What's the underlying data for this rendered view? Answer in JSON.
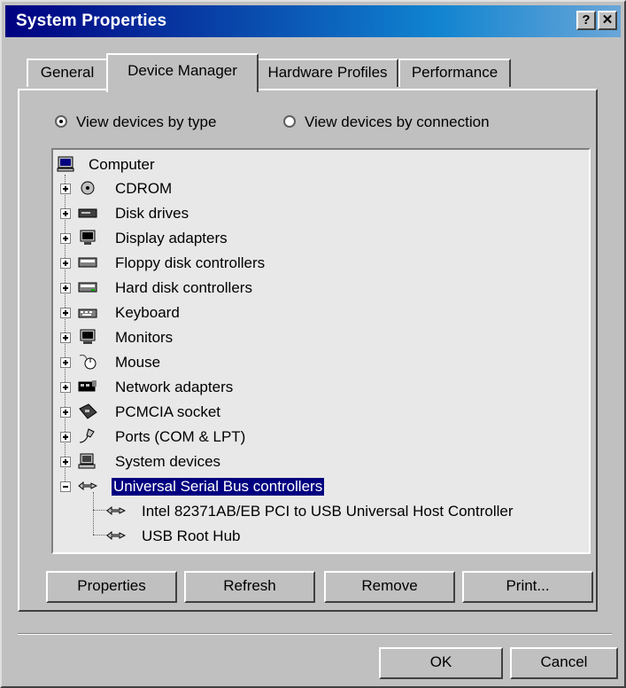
{
  "window": {
    "title": "System Properties",
    "help_glyph": "?",
    "close_glyph": "✕"
  },
  "tabs": [
    {
      "label": "General",
      "active": false
    },
    {
      "label": "Device Manager",
      "active": true
    },
    {
      "label": "Hardware Profiles",
      "active": false
    },
    {
      "label": "Performance",
      "active": false
    }
  ],
  "view_options": {
    "by_type": "View devices by type",
    "by_connection": "View devices by connection",
    "selected": "by_type"
  },
  "tree": {
    "root": {
      "label": "Computer",
      "icon": "computer-icon"
    },
    "categories": [
      {
        "label": "CDROM",
        "icon": "cdrom-icon",
        "expanded": false
      },
      {
        "label": "Disk drives",
        "icon": "disk-drive-icon",
        "expanded": false
      },
      {
        "label": "Display adapters",
        "icon": "display-adapter-icon",
        "expanded": false
      },
      {
        "label": "Floppy disk controllers",
        "icon": "floppy-controller-icon",
        "expanded": false
      },
      {
        "label": "Hard disk controllers",
        "icon": "hard-disk-controller-icon",
        "expanded": false
      },
      {
        "label": "Keyboard",
        "icon": "keyboard-icon",
        "expanded": false
      },
      {
        "label": "Monitors",
        "icon": "monitor-icon",
        "expanded": false
      },
      {
        "label": "Mouse",
        "icon": "mouse-icon",
        "expanded": false
      },
      {
        "label": "Network adapters",
        "icon": "network-adapter-icon",
        "expanded": false
      },
      {
        "label": "PCMCIA socket",
        "icon": "pcmcia-icon",
        "expanded": false
      },
      {
        "label": "Ports (COM & LPT)",
        "icon": "port-icon",
        "expanded": false
      },
      {
        "label": "System devices",
        "icon": "system-device-icon",
        "expanded": false
      },
      {
        "label": "Universal Serial Bus controllers",
        "icon": "usb-icon",
        "expanded": true,
        "selected": true
      }
    ],
    "usb_children": [
      {
        "label": "Intel 82371AB/EB PCI to USB Universal Host Controller",
        "icon": "usb-icon"
      },
      {
        "label": "USB Root Hub",
        "icon": "usb-icon"
      }
    ]
  },
  "buttons": {
    "properties": "Properties",
    "refresh": "Refresh",
    "remove": "Remove",
    "print": "Print...",
    "ok": "OK",
    "cancel": "Cancel"
  }
}
